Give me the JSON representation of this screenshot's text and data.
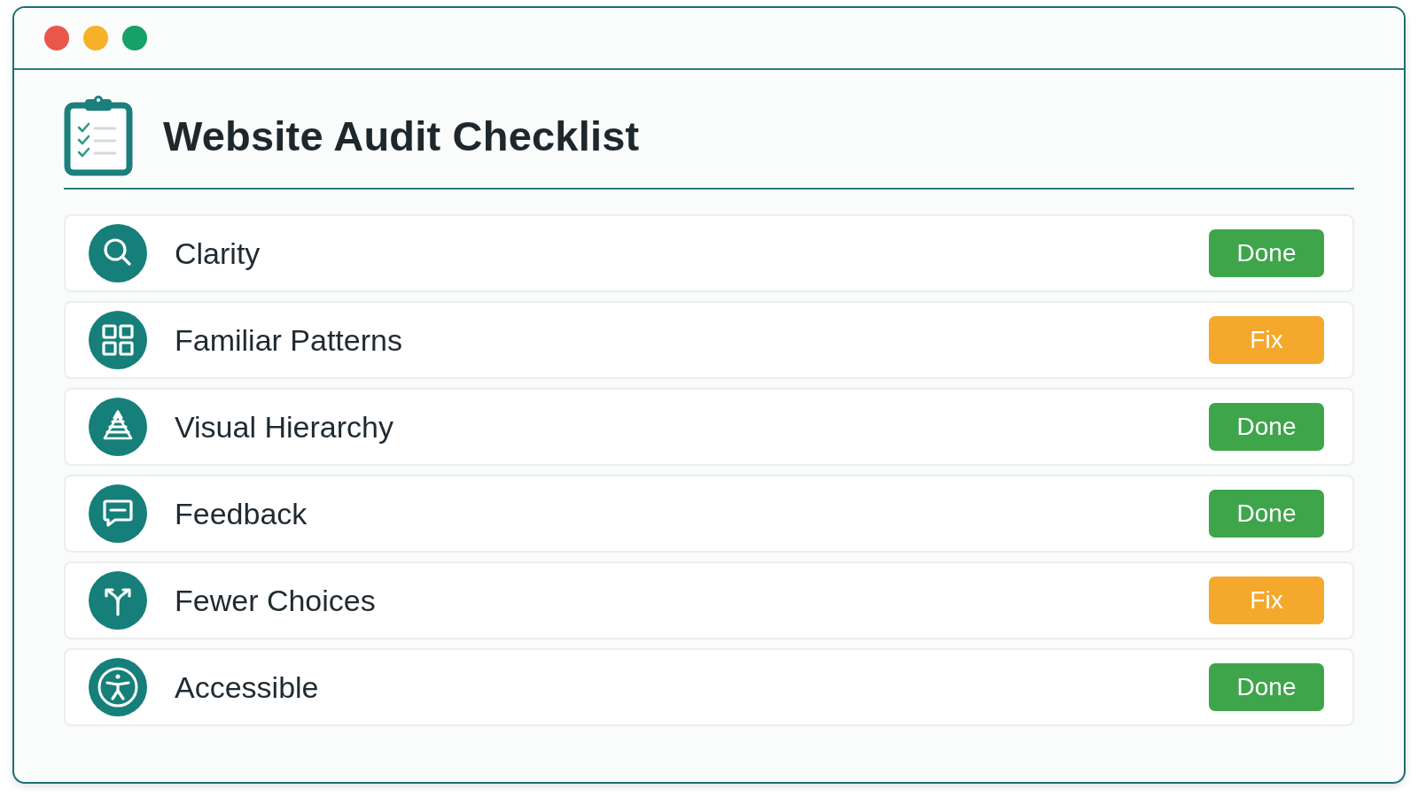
{
  "header": {
    "title": "Website Audit Checklist"
  },
  "checklist": {
    "items": [
      {
        "label": "Clarity",
        "status": {
          "text": "Done",
          "kind": "done"
        }
      },
      {
        "label": "Familiar Patterns",
        "status": {
          "text": "Fix",
          "kind": "fix"
        }
      },
      {
        "label": "Visual Hierarchy",
        "status": {
          "text": "Done",
          "kind": "done"
        }
      },
      {
        "label": "Feedback",
        "status": {
          "text": "Done",
          "kind": "done"
        }
      },
      {
        "label": "Fewer Choices",
        "status": {
          "text": "Fix",
          "kind": "fix"
        }
      },
      {
        "label": "Accessible",
        "status": {
          "text": "Done",
          "kind": "done"
        }
      }
    ]
  }
}
